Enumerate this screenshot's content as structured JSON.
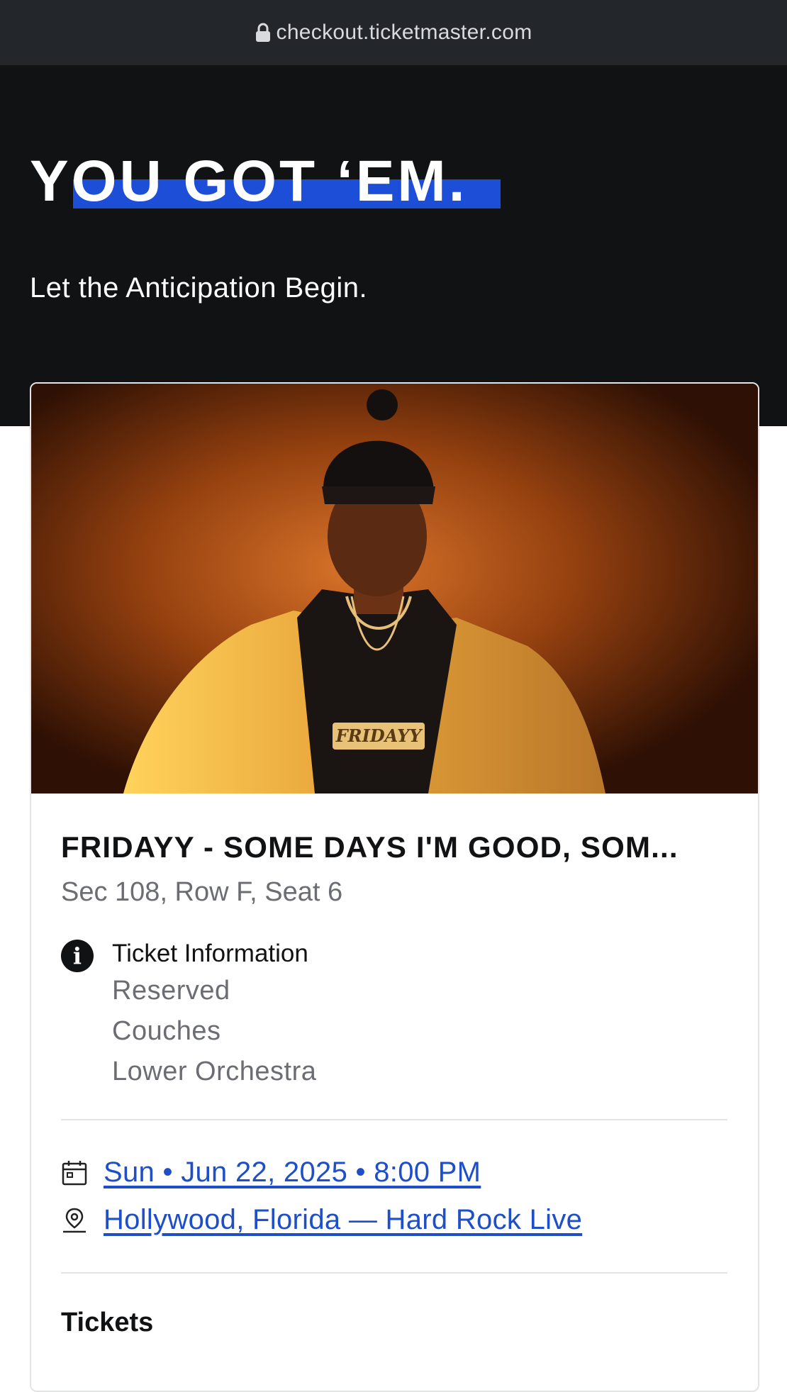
{
  "browser": {
    "url": "checkout.ticketmaster.com"
  },
  "hero": {
    "title": "YOU GOT ‘EM.",
    "subtitle": "Let the Anticipation Begin."
  },
  "event": {
    "title": "FRIDAYY - SOME DAYS I'M GOOD, SOM...",
    "seat": "Sec 108, Row F, Seat 6",
    "ticket_info": {
      "heading": "Ticket Information",
      "lines": [
        "Reserved",
        "Couches",
        "Lower Orchestra"
      ]
    },
    "date_time": "Sun • Jun 22, 2025 • 8:00 PM",
    "location": "Hollywood, Florida — Hard Rock Live",
    "pendant_text": "FRIDAYY"
  },
  "tickets_heading": "Tickets",
  "icons": {
    "lock": "lock-icon",
    "info": "info-icon",
    "calendar": "calendar-icon",
    "location": "map-pin-icon"
  },
  "colors": {
    "hero_bg": "#111214",
    "accent_underline": "#1d4ed8",
    "link": "#1e4fc9"
  }
}
